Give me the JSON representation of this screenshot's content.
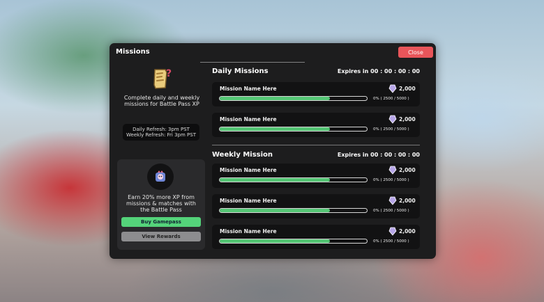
{
  "window": {
    "title": "Missions",
    "close_label": "Close"
  },
  "sidebar": {
    "info_text": "Complete daily and weekly missions for Battle Pass XP",
    "refresh_daily": "Daily Refresh: 3pm PST",
    "refresh_weekly": "Weekly Refresh: Fri 3pm PST",
    "gamepass_text": "Earn 20% more XP from missions & matches with the Battle Pass",
    "buy_label": "Buy Gamepass",
    "view_label": "View Rewards"
  },
  "daily": {
    "title": "Daily Missions",
    "expires": "Expires in 00 : 00 : 00 : 00",
    "missions": [
      {
        "name": "Mission Name Here",
        "reward": "2,000",
        "progress": "0%  ( 2500 / 5000 )",
        "fill": 0.75
      },
      {
        "name": "Mission Name Here",
        "reward": "2,000",
        "progress": "0%  ( 2500 / 5000 )",
        "fill": 0.75
      }
    ]
  },
  "weekly": {
    "title": "Weekly Mission",
    "expires": "Expires in 00 : 00 : 00 : 00",
    "missions": [
      {
        "name": "Mission Name Here",
        "reward": "2,000",
        "progress": "0%  ( 2500 / 5000 )",
        "fill": 0.75
      },
      {
        "name": "Mission Name Here",
        "reward": "2,000",
        "progress": "0%  ( 2500 / 5000 )",
        "fill": 0.75
      },
      {
        "name": "Mission Name Here",
        "reward": "2,000",
        "progress": "0%  ( 2500 / 5000 )",
        "fill": 0.75
      }
    ]
  },
  "colors": {
    "close": "#e8555a",
    "buy": "#54d37a",
    "progress_fill": "#54c574",
    "panel": "#1d1d1e"
  }
}
